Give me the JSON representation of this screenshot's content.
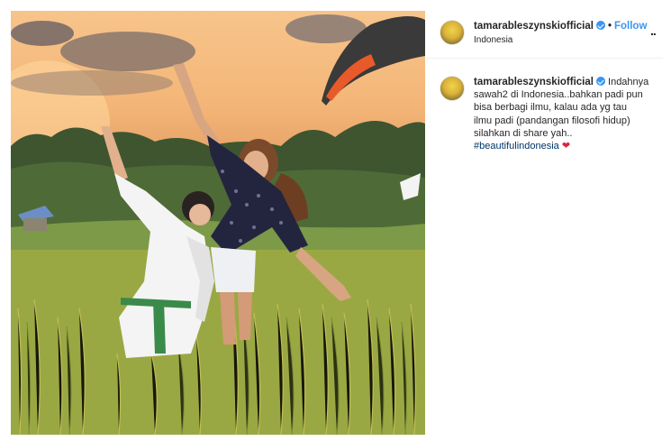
{
  "post": {
    "username": "tamarableszynskiofficial",
    "follow_label": "Follow",
    "separator": "•",
    "location": "Indonesia",
    "more_label": "..",
    "caption": {
      "username": "tamarableszynskiofficial",
      "lines": [
        "Indahnya",
        "sawah2 di Indonesia..bahkan padi pun",
        "bisa berbagi ilmu, kalau ada yg tau",
        "ilmu padi (pandangan filosofi hidup)",
        "silahkan di share yah.."
      ],
      "hashtag": "#beautifulindonesia",
      "emoji": "❤"
    }
  },
  "colors": {
    "accent": "#3897f0",
    "hashtag": "#003569",
    "heart": "#d7263d"
  }
}
